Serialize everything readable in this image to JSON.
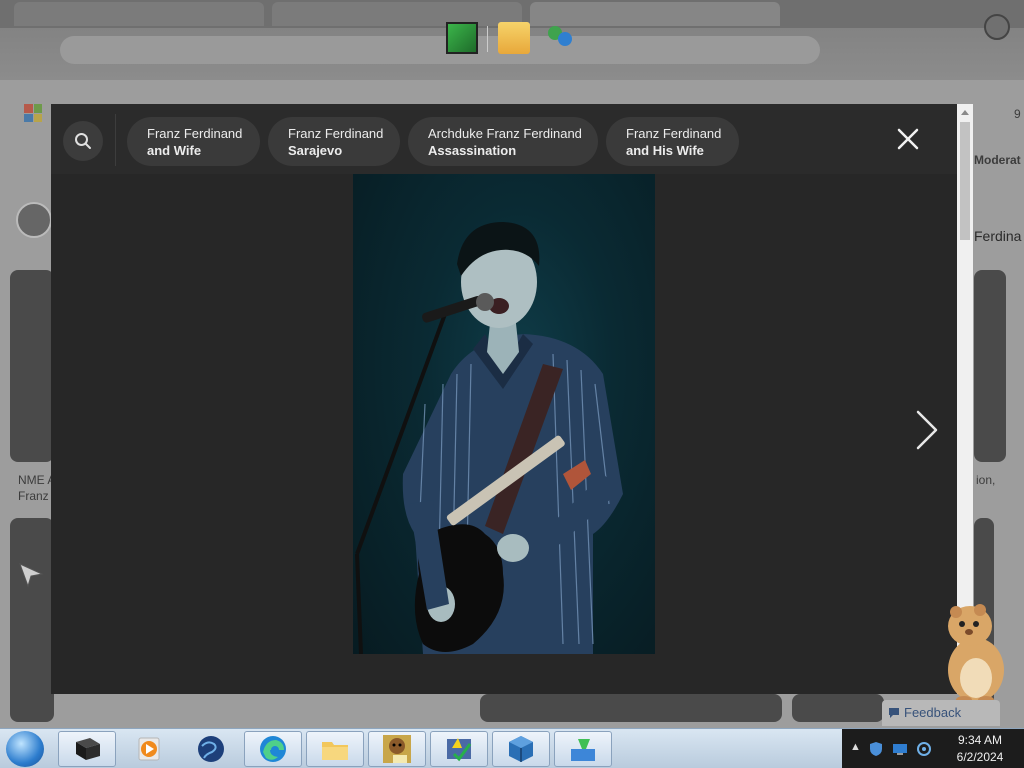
{
  "search": {
    "icon": "search-icon",
    "chips": [
      {
        "line1": "Franz Ferdinand",
        "line2": "and Wife"
      },
      {
        "line1": "Franz Ferdinand",
        "line2": "Sarajevo"
      },
      {
        "line1": "Archduke Franz Ferdinand",
        "line2": "Assassination"
      },
      {
        "line1": "Franz Ferdinand",
        "line2": "and His Wife"
      }
    ]
  },
  "overlay": {
    "close_icon": "close-icon",
    "next_icon": "chevron-right-icon",
    "photo_icon": "photo-musician-singing-with-guitar"
  },
  "background": {
    "left_caption_line1": "NME A",
    "left_caption_line2": "Franz",
    "right_tab_fragment": "Ferdina",
    "right_caption_fragment": "ion,",
    "moderate_fragment": "Moderat",
    "number_fragment": "9"
  },
  "feedback": {
    "label": "Feedback"
  },
  "taskbar": {
    "clock_time": "9:34 AM",
    "clock_date": "6/2/2024",
    "pinned": [
      "terminal-icon",
      "media-player-icon",
      "globe-icon",
      "edge-icon",
      "file-explorer-icon",
      "box-app-icon",
      "task-check-icon",
      "virtualbox-icon",
      "installer-icon"
    ]
  },
  "colors": {
    "overlay_bg": "#272727",
    "chip_bg": "#3a3a3a",
    "taskbar_bg": "#c9d9ea"
  }
}
